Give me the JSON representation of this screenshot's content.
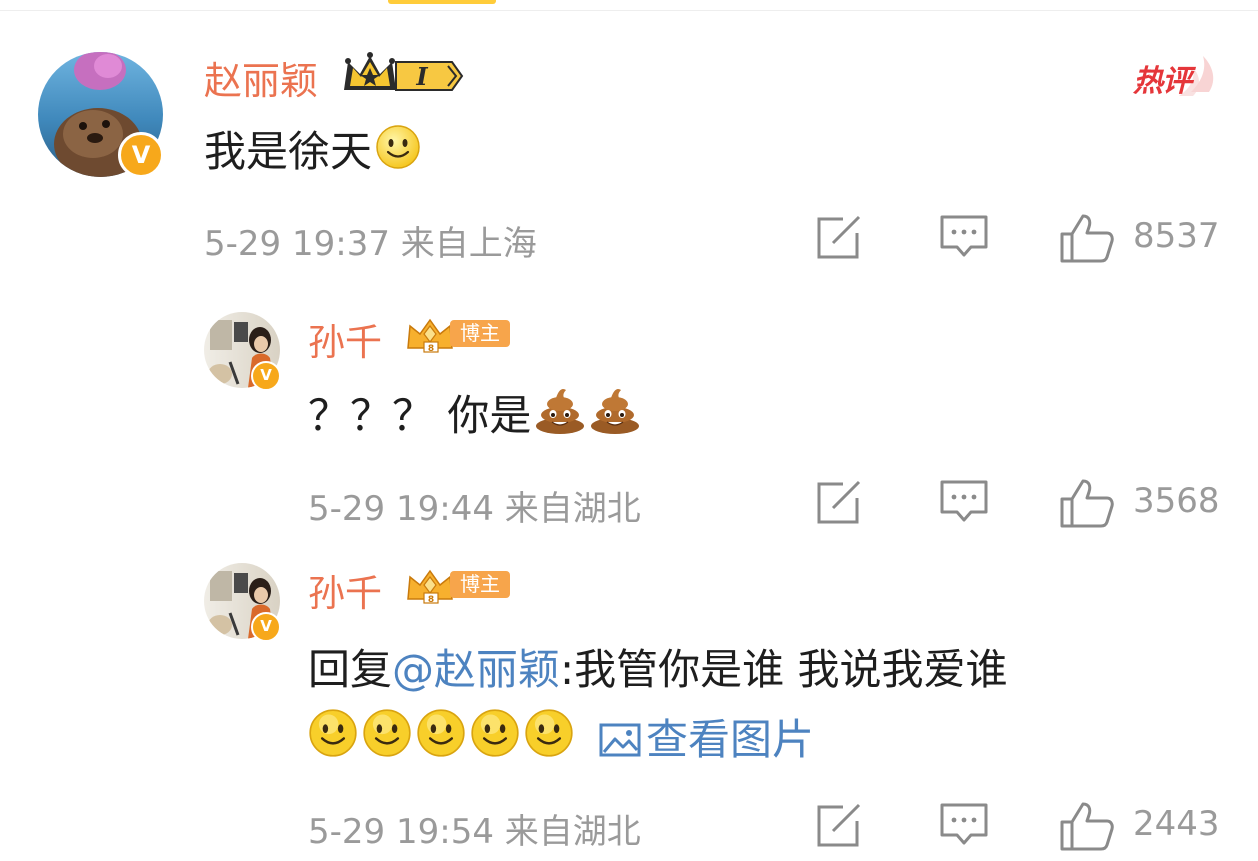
{
  "hot_tag": "热评",
  "comments": [
    {
      "username": "赵丽颖",
      "level_badge": "I",
      "verified_mark": "V",
      "text": "我是徐天",
      "emojis": [
        "smile-emoji"
      ],
      "date": "5-29",
      "time": "19:37",
      "location": "来自上海",
      "likes": "8537"
    }
  ],
  "replies": [
    {
      "username": "孙千",
      "badge_label": "博主",
      "verified_mark": "V",
      "text": "？？？ 你是",
      "emojis": [
        "poop-emoji",
        "poop-emoji"
      ],
      "date": "5-29",
      "time": "19:44",
      "location": "来自湖北",
      "likes": "3568"
    },
    {
      "username": "孙千",
      "badge_label": "博主",
      "verified_mark": "V",
      "reply_prefix": "回复",
      "mention": "@赵丽颖",
      "text": ":我管你是谁 我说我爱谁",
      "emojis": [
        "smile-emoji",
        "smile-emoji",
        "smile-emoji",
        "smile-emoji",
        "smile-emoji"
      ],
      "view_image_label": "查看图片",
      "date": "5-29",
      "time": "19:54",
      "location": "来自湖北",
      "likes": "2443"
    }
  ],
  "icons": {
    "forward": "share-icon",
    "comment": "comment-icon",
    "like": "thumbs-up-icon",
    "image": "image-icon"
  },
  "colors": {
    "username": "#eb7350",
    "mention_link": "#4d83c0",
    "meta_gray": "#9a9a9a",
    "verified": "#f7a81b",
    "hot_red": "#e5363a"
  }
}
